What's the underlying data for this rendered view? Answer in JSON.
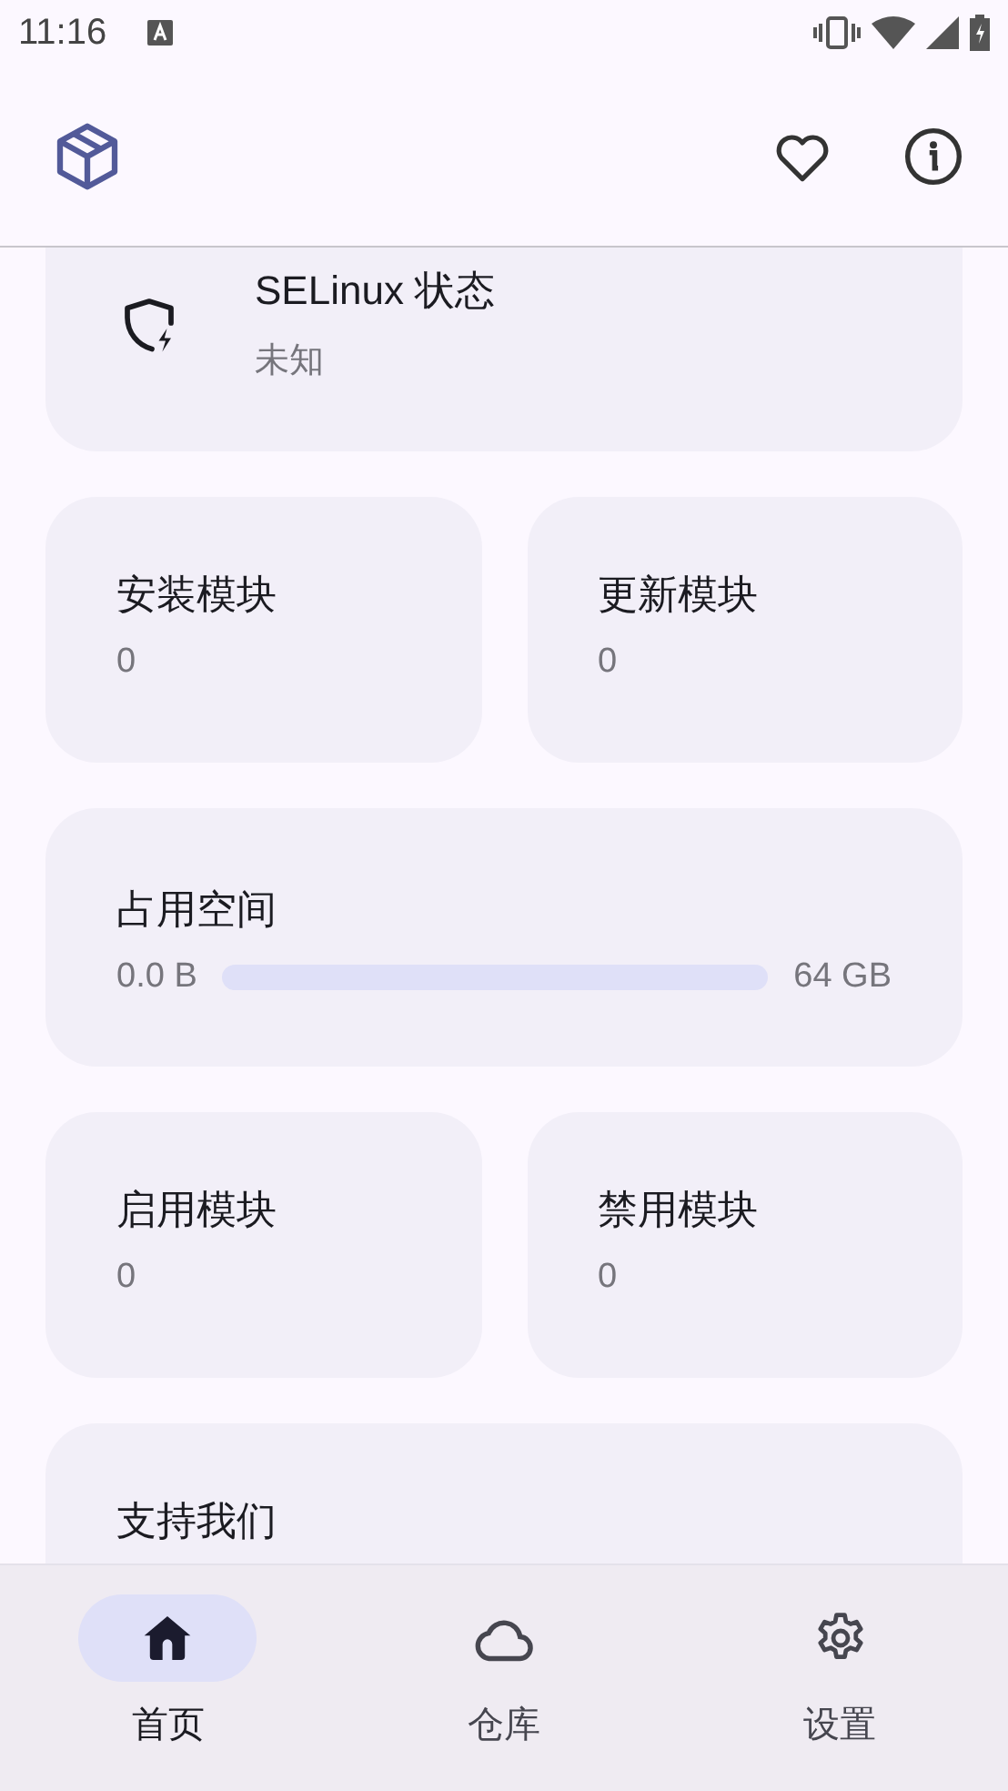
{
  "status_bar": {
    "time": "11:16"
  },
  "selinux": {
    "title": "SELinux 状态",
    "value": "未知"
  },
  "module_counts_top": [
    {
      "label": "安装模块",
      "value": "0"
    },
    {
      "label": "更新模块",
      "value": "0"
    }
  ],
  "storage": {
    "title": "占用空间",
    "used": "0.0 B",
    "total": "64 GB",
    "level": 0
  },
  "module_counts_bottom": [
    {
      "label": "启用模块",
      "value": "0"
    },
    {
      "label": "禁用模块",
      "value": "0"
    }
  ],
  "support": {
    "title": "支持我们"
  },
  "nav": [
    {
      "kind": "home",
      "label": "首页",
      "selected": true
    },
    {
      "kind": "cloud",
      "label": "仓库",
      "selected": false
    },
    {
      "kind": "settings",
      "label": "设置",
      "selected": false
    }
  ]
}
